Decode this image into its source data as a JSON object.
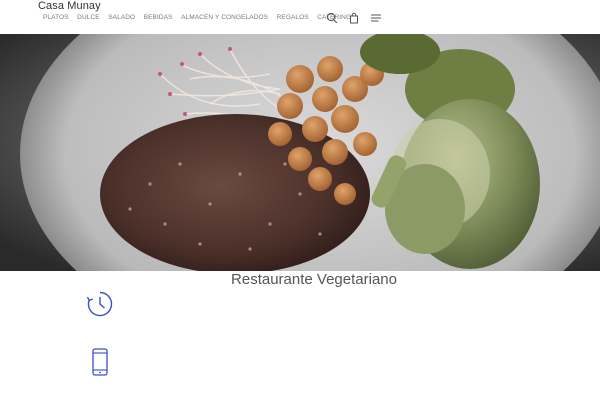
{
  "header": {
    "brand": "Casa Munay",
    "nav": [
      "PLATOS",
      "DULCE",
      "SALADO",
      "BEBIDAS",
      "ALMACEN Y CONGELADOS",
      "REGALOS",
      "CATERING"
    ],
    "icons": [
      "search-icon",
      "shopping-bag-icon",
      "menu-icon"
    ]
  },
  "hero": {
    "image": "plate with quinoa, chickpeas, sprouts and broccoli",
    "slide_count": 1
  },
  "main": {
    "title": "Restaurante Vegetariano",
    "feature_icons": [
      "clock-icon",
      "mobile-phone-icon"
    ]
  },
  "colors": {
    "accent": "#3a4fc9",
    "text": "#555555",
    "nav_text": "#7a7a7a"
  }
}
